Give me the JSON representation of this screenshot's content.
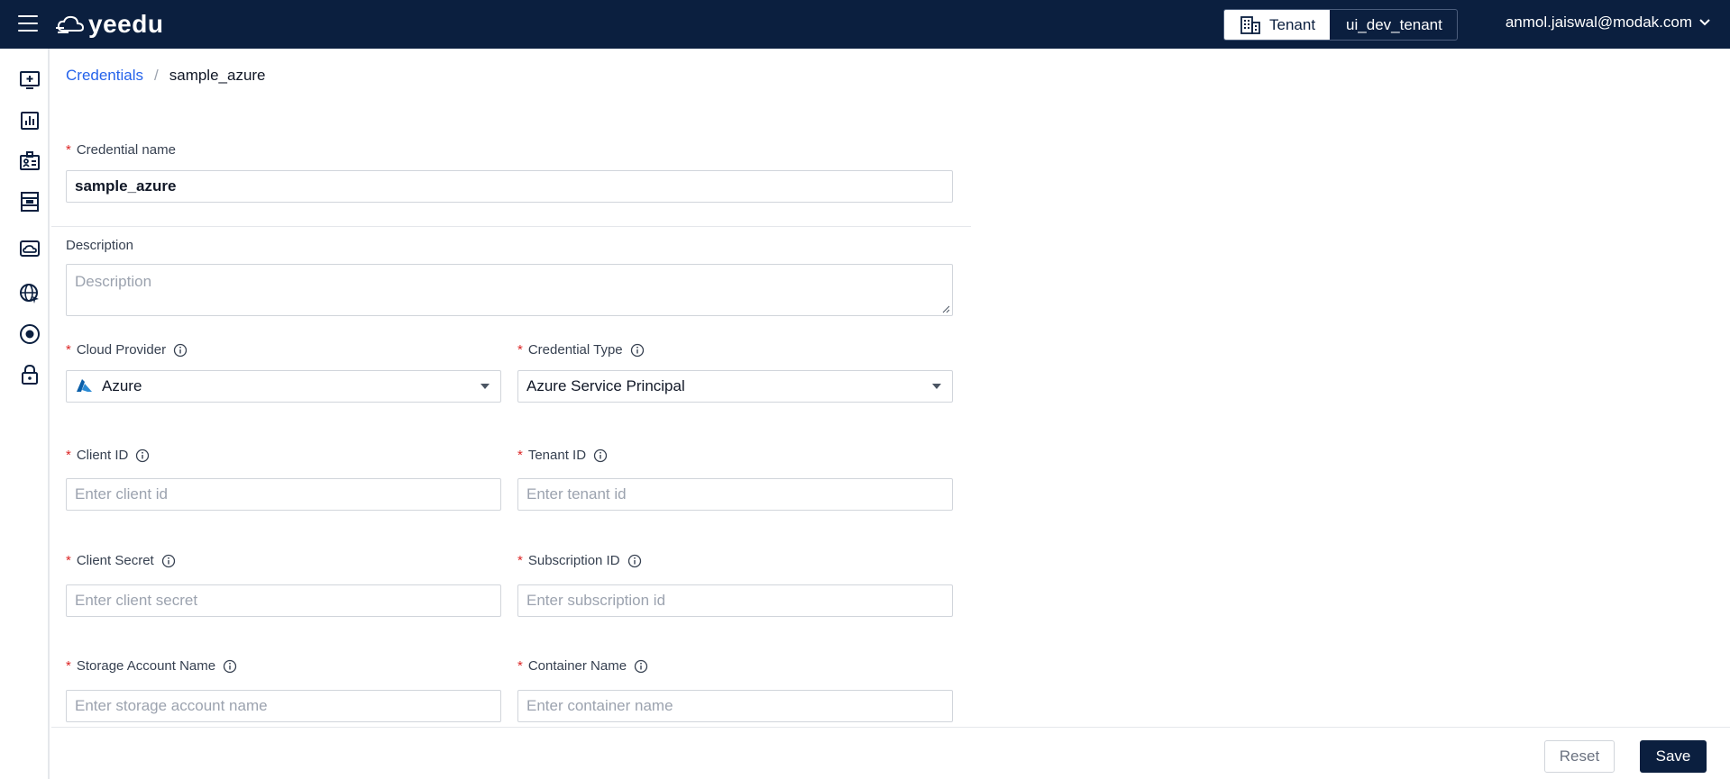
{
  "header": {
    "logo_text": "yeedu",
    "tenant_label": "Tenant",
    "tenant_value": "ui_dev_tenant",
    "user_email": "anmol.jaiswal@modak.com"
  },
  "sidebar": {
    "items": [
      {
        "icon": "add-monitor-icon"
      },
      {
        "icon": "dashboard-chart-icon"
      },
      {
        "icon": "id-card-icon"
      },
      {
        "icon": "workspace-icon"
      },
      {
        "icon": "cloud-drive-icon"
      },
      {
        "icon": "globe-network-icon"
      },
      {
        "icon": "target-icon"
      },
      {
        "icon": "lock-icon"
      }
    ]
  },
  "breadcrumb": {
    "parent": "Credentials",
    "separator": "/",
    "current": "sample_azure"
  },
  "form": {
    "credential_name": {
      "label": "Credential name",
      "value": "sample_azure"
    },
    "description": {
      "label": "Description",
      "placeholder": "Description"
    },
    "cloud_provider": {
      "label": "Cloud Provider",
      "value": "Azure"
    },
    "credential_type": {
      "label": "Credential Type",
      "value": "Azure Service Principal"
    },
    "client_id": {
      "label": "Client ID",
      "placeholder": "Enter client id"
    },
    "tenant_id": {
      "label": "Tenant ID",
      "placeholder": "Enter tenant id"
    },
    "client_secret": {
      "label": "Client Secret",
      "placeholder": "Enter client secret"
    },
    "subscription_id": {
      "label": "Subscription ID",
      "placeholder": "Enter subscription id"
    },
    "storage_account_name": {
      "label": "Storage Account Name",
      "placeholder": "Enter storage account name"
    },
    "container_name": {
      "label": "Container Name",
      "placeholder": "Enter container name"
    },
    "required_mark": "*"
  },
  "footer": {
    "reset_label": "Reset",
    "save_label": "Save"
  },
  "colors": {
    "header_bg": "#0b1f3f",
    "link": "#2563eb",
    "required": "#dc2626"
  }
}
